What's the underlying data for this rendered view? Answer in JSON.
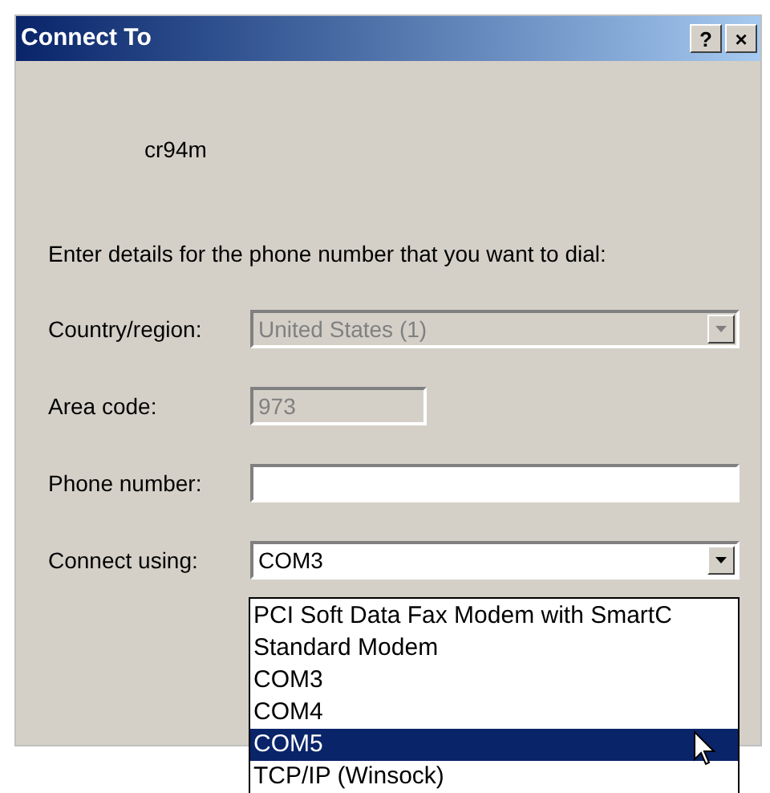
{
  "window": {
    "title": "Connect To",
    "buttons": [
      "?",
      "×"
    ]
  },
  "connection_name": "cr94m",
  "instruction": "Enter details for the phone number that you want to dial:",
  "fields": [
    {
      "kind": "combo",
      "label": "Country/region:",
      "value": "United States (1)",
      "disabled": true
    },
    {
      "kind": "text",
      "label": "Area code:",
      "value": "973",
      "disabled": true
    },
    {
      "kind": "text",
      "label": "Phone number:",
      "disabled": false
    },
    {
      "kind": "combo",
      "label": "Connect using:",
      "value": "COM3",
      "disabled": false
    }
  ],
  "dropdown": {
    "expanded": true,
    "items": [
      {
        "label": "PCI Soft Data Fax Modem with SmartC",
        "selected": false
      },
      {
        "label": "Standard Modem",
        "selected": false
      },
      {
        "label": "COM3",
        "selected": false
      },
      {
        "label": "COM4",
        "selected": false
      },
      {
        "label": "COM5",
        "selected": true
      },
      {
        "label": "TCP/IP (Winsock)",
        "selected": false
      }
    ]
  }
}
